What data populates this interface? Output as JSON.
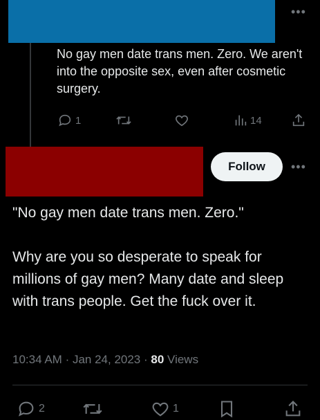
{
  "parent_tweet": {
    "text": "No gay men date trans men. Zero. We aren't into the opposite sex, even after cosmetic surgery.",
    "reply_count": "1",
    "view_count": "14"
  },
  "main_tweet": {
    "follow_label": "Follow",
    "text": "\"No gay men date trans men. Zero.\"\n\nWhy are you so desperate to speak for millions of gay men? Many date and sleep with trans people. Get the fuck over it.",
    "time": "10:34 AM",
    "date": "Jan 24, 2023",
    "views_count": "80",
    "views_label": "Views",
    "reply_count": "2",
    "like_count": "1"
  },
  "icons": [
    "more-icon",
    "reply-icon",
    "retweet-icon",
    "like-icon",
    "views-icon",
    "share-icon",
    "bookmark-icon"
  ],
  "colors": {
    "background": "#000000",
    "text": "#e7e9ea",
    "muted": "#71767b",
    "redact_blue": "#0a6fa8",
    "redact_red": "#8b0000"
  }
}
